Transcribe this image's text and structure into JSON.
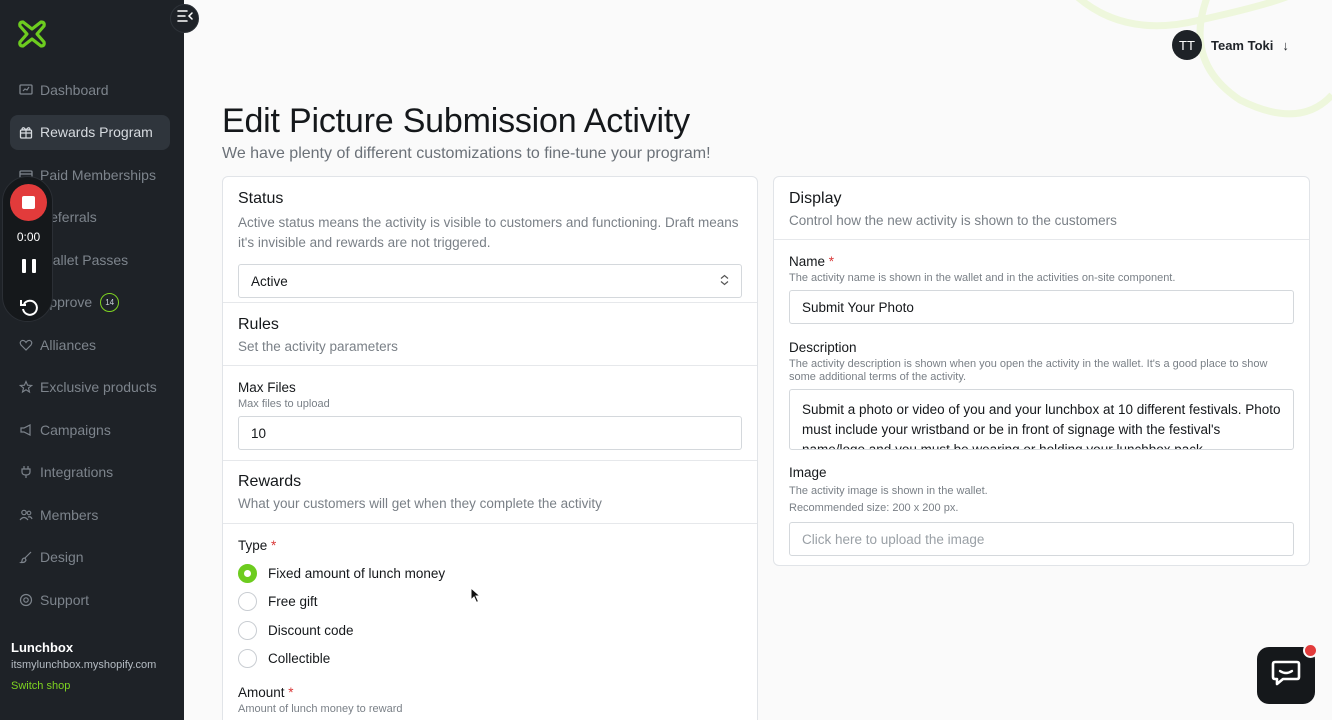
{
  "sidebar": {
    "logo_icon": "lunchbox-logo-icon",
    "items": [
      {
        "label": "Dashboard",
        "icon": "dashboard-icon",
        "active": false
      },
      {
        "label": "Rewards Program",
        "icon": "gift-icon",
        "active": true
      },
      {
        "label": "Paid Memberships",
        "icon": "card-icon",
        "active": false
      },
      {
        "label": "Referrals",
        "icon": "referral-icon",
        "active": false
      },
      {
        "label": "Wallet Passes",
        "icon": "wallet-icon",
        "active": false
      },
      {
        "label": "Approve",
        "icon": "check-icon",
        "active": false,
        "badge": "14"
      },
      {
        "label": "Alliances",
        "icon": "heart-handshake-icon",
        "active": false
      },
      {
        "label": "Exclusive products",
        "icon": "star-icon",
        "active": false
      },
      {
        "label": "Campaigns",
        "icon": "megaphone-icon",
        "active": false
      },
      {
        "label": "Integrations",
        "icon": "plug-icon",
        "active": false
      },
      {
        "label": "Members",
        "icon": "users-icon",
        "active": false
      },
      {
        "label": "Design",
        "icon": "brush-icon",
        "active": false
      },
      {
        "label": "Support",
        "icon": "help-icon",
        "active": false
      }
    ],
    "shop": {
      "name": "Lunchbox",
      "url": "itsmylunchbox.myshopify.com",
      "switch_label": "Switch shop"
    }
  },
  "recorder": {
    "time": "0:00"
  },
  "user": {
    "initials": "TT",
    "name": "Team Toki",
    "arrow": "↓"
  },
  "header": {
    "title": "Edit Picture Submission Activity",
    "subtitle": "We have plenty of different customizations to fine-tune your program!"
  },
  "status": {
    "title": "Status",
    "description": "Active status means the activity is visible to customers and functioning. Draft means it's invisible and rewards are not triggered.",
    "value": "Active"
  },
  "rules": {
    "title": "Rules",
    "description": "Set the activity parameters",
    "max_files_label": "Max Files",
    "max_files_help": "Max files to upload",
    "max_files_value": "10"
  },
  "rewards": {
    "title": "Rewards",
    "description": "What your customers will get when they complete the activity",
    "type_label": "Type",
    "required_mark": "*",
    "options": [
      {
        "label": "Fixed amount of lunch money",
        "selected": true
      },
      {
        "label": "Free gift",
        "selected": false
      },
      {
        "label": "Discount code",
        "selected": false
      },
      {
        "label": "Collectible",
        "selected": false
      }
    ],
    "amount_label": "Amount",
    "amount_help": "Amount of lunch money to reward"
  },
  "display": {
    "title": "Display",
    "description": "Control how the new activity is shown to the customers",
    "name_label": "Name",
    "name_help": "The activity name is shown in the wallet and in the activities on-site component.",
    "name_value": "Submit Your Photo",
    "description_label": "Description",
    "description_help": "The activity description is shown when you open the activity in the wallet. It's a good place to show some additional terms of the activity.",
    "description_value": "Submit a photo or video of you and your lunchbox at 10 different festivals. Photo must include your wristband or be in front of signage with the festival's name/logo and you must be wearing or holding your lunchbox pack",
    "image_label": "Image",
    "image_help_1": "The activity image is shown in the wallet.",
    "image_help_2": "Recommended size: 200 x 200 px.",
    "image_placeholder": "Click here to upload the image"
  },
  "colors": {
    "accent": "#6dcc1f",
    "sidebar_bg": "#1e2227",
    "record": "#e23b3b"
  }
}
